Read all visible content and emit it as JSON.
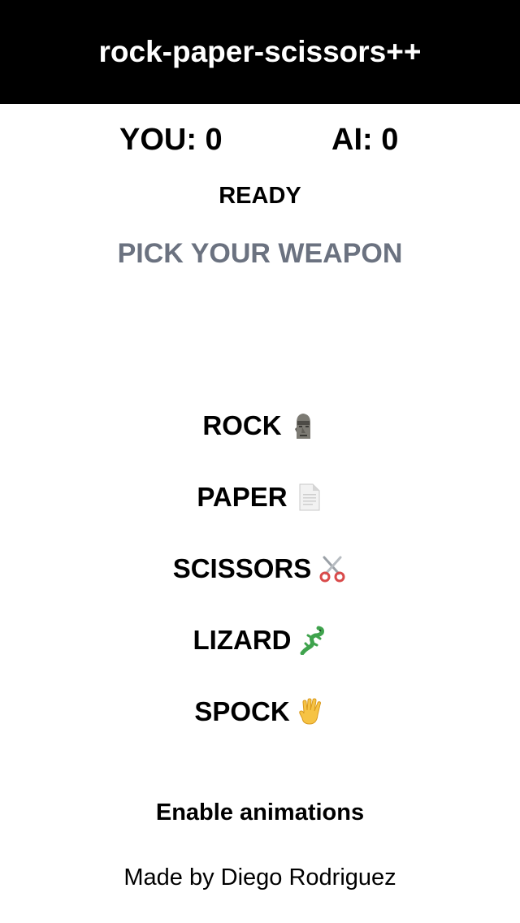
{
  "header": {
    "title": "rock-paper-scissors++"
  },
  "score": {
    "you": "YOU: 0",
    "ai": "AI: 0"
  },
  "status": "READY",
  "prompt": "PICK YOUR WEAPON",
  "weapons": [
    {
      "label": "ROCK",
      "icon": "moai-icon"
    },
    {
      "label": "PAPER",
      "icon": "page-icon"
    },
    {
      "label": "SCISSORS",
      "icon": "scissors-icon"
    },
    {
      "label": "LIZARD",
      "icon": "lizard-icon"
    },
    {
      "label": "SPOCK",
      "icon": "vulcan-salute-icon"
    }
  ],
  "animations_toggle": "Enable animations",
  "footer": "Made by Diego Rodriguez",
  "colors": {
    "header_bg": "#000000",
    "header_text": "#ffffff",
    "prompt_text": "#6b7280"
  }
}
